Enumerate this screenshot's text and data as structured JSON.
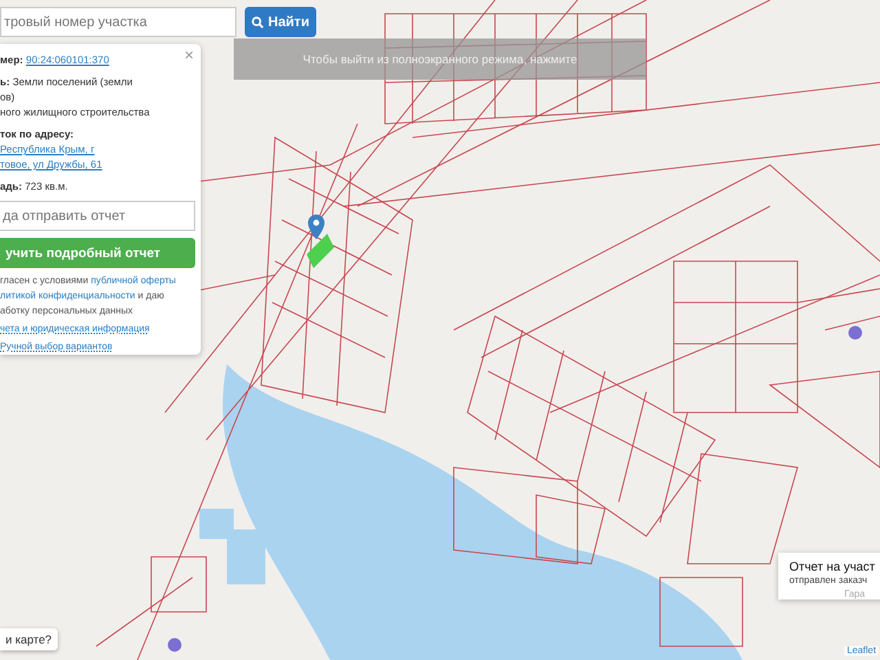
{
  "search": {
    "placeholder": "тровый номер участка",
    "button": "Найти"
  },
  "fullscreen_notice": {
    "text": "Чтобы выйти из полноэкранного режима, нажмите"
  },
  "parcel_card": {
    "close": "×",
    "cadastral": {
      "label": "мер:",
      "value": "90:24:060101:370"
    },
    "category": {
      "lines": [
        "**ь:** Земли поселений (земли",
        "ов)",
        "ного жилищного строительства"
      ]
    },
    "address": {
      "label": "ток по адресу:",
      "lines": [
        "Республика Крым, г",
        "товое, ул Дружбы, 61"
      ]
    },
    "area": {
      "label": "адь:",
      "value": "723 кв.м."
    },
    "email": {
      "placeholder": "да отправить отчет"
    },
    "report_button": "учить подробный отчет",
    "consent": [
      [
        {
          "kind": "text",
          "text": "гласен с условиями "
        },
        {
          "kind": "link",
          "text": "публичной оферты"
        }
      ],
      [
        {
          "kind": "link",
          "text": "литикой конфиденциальности"
        },
        {
          "kind": "text",
          "text": " и даю"
        }
      ],
      [
        {
          "kind": "text",
          "text": "аботку персональных данных"
        }
      ]
    ],
    "links": [
      "чета и юридическая информация",
      "Ручной выбор вариантов"
    ]
  },
  "map_question": "и карте?",
  "notification": {
    "title": "Отчет на участ",
    "text": "отправлен заказч",
    "link": "Гара"
  },
  "attribution": "Leaflet"
}
